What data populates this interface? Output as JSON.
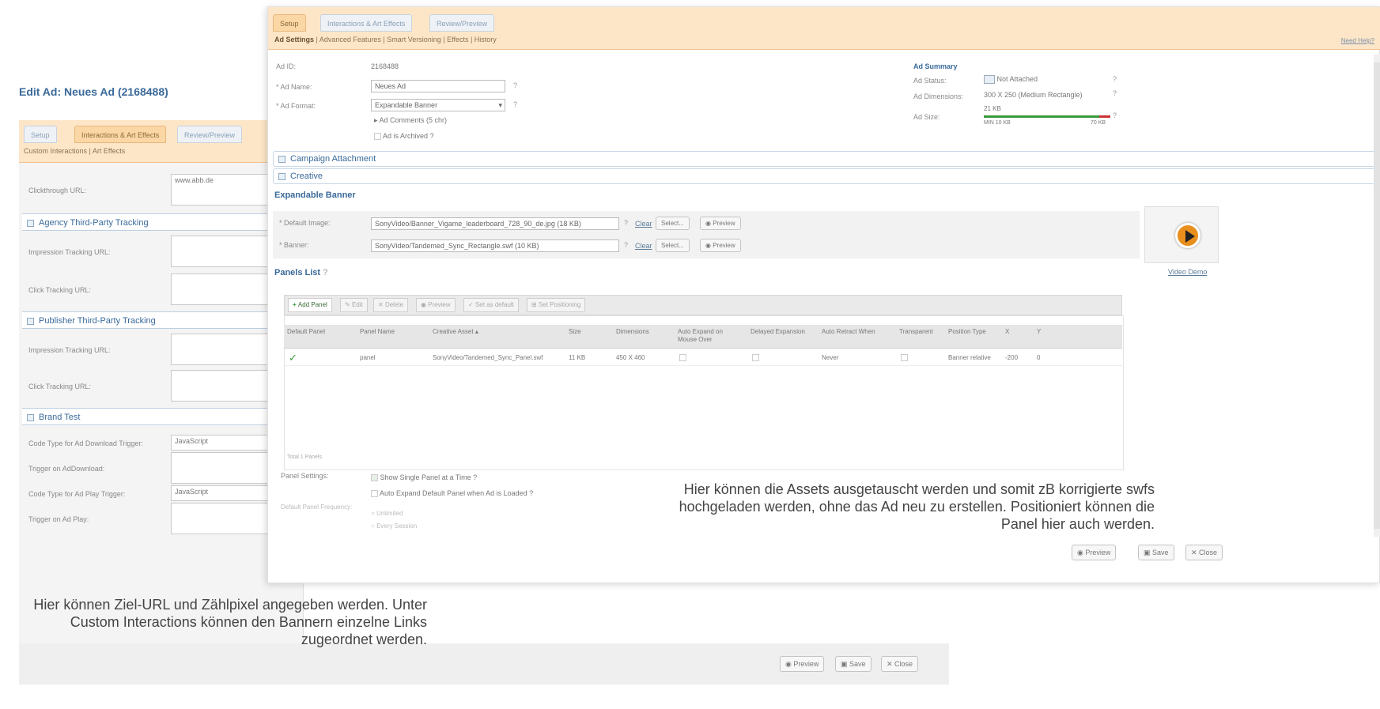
{
  "back": {
    "title": "Edit Ad: Neues Ad (2168488)",
    "tabs": [
      "Setup",
      "Interactions & Art Effects",
      "Review/Preview"
    ],
    "subnav": "Custom Interactions  |  Art Effects",
    "clickthrough_label": "Clickthrough URL:",
    "clickthrough_value": "www.abb.de",
    "agency_section": "Agency Third-Party Tracking",
    "impression_label": "Impression Tracking URL:",
    "click_label": "Click Tracking URL:",
    "publisher_section": "Publisher Third-Party Tracking",
    "pub_impression_label": "Impression Tracking URL:",
    "pub_click_label": "Click Tracking URL:",
    "brand_section": "Brand Test",
    "code_download_label": "Code Type for Ad Download Trigger:",
    "code_download_value": "JavaScript",
    "trigger_download_label": "Trigger on AdDownload:",
    "code_play_label": "Code Type for Ad Play Trigger:",
    "code_play_value": "JavaScript",
    "trigger_play_label": "Trigger on Ad Play:",
    "preview_btn": "Preview",
    "save_btn": "Save",
    "close_btn": "Close"
  },
  "front": {
    "tabs": [
      "Setup",
      "Interactions & Art Effects",
      "Review/Preview"
    ],
    "subnav_active": "Ad Settings",
    "subnav_rest": "  |  Advanced Features  |  Smart Versioning  |  Effects  |  History",
    "help_link": "Need Help?",
    "ad_id_label": "Ad ID:",
    "ad_id_value": "2168488",
    "ad_name_label": "* Ad Name:",
    "ad_name_value": "Neues Ad",
    "ad_format_label": "* Ad Format:",
    "ad_format_value": "Expandable Banner",
    "ad_comments": "Ad Comments (5 chr)",
    "archived": "Ad is Archived",
    "summary_title": "Ad Summary",
    "summary_status_label": "Ad Status:",
    "summary_status_value": "Not Attached",
    "summary_dims_label": "Ad Dimensions:",
    "summary_dims_value": "300 X 250 (Medium Rectangle)",
    "summary_size_label": "Ad Size:",
    "summary_size_top": "21 KB",
    "summary_size_scale": [
      "MIN 10 KB",
      "70 KB"
    ],
    "campaign_section": "Campaign Attachment",
    "creative_section": "Creative",
    "expandable_title": "Expandable Banner",
    "default_image_label": "* Default Image:",
    "default_image_value": "SonyVideo/Banner_Vigame_leaderboard_728_90_de.jpg (18 KB)",
    "banner_label": "* Banner:",
    "banner_value": "SonyVideo/Tandemed_Sync_Rectangle.swf (10 KB)",
    "clear": "Clear",
    "select": "Select...",
    "preview": "Preview",
    "video_demo": "Video Demo",
    "panels_title": "Panels List",
    "toolbar": [
      "Add Panel",
      "Edit",
      "Delete",
      "Preview",
      "Set as default",
      "Set Positioning"
    ],
    "columns": [
      "Default Panel",
      "Panel Name",
      "Creative Asset",
      "Size",
      "Dimensions",
      "Auto Expand on Mouse Over",
      "Delayed Expansion",
      "Auto Retract When",
      "Transparent",
      "Position Type",
      "X",
      "Y"
    ],
    "rows": [
      {
        "default": "✓",
        "name": "panel",
        "asset": "SonyVideo/Tandemed_Sync_Panel.swf",
        "size": "11 KB",
        "dims": "450 X 460",
        "retract": "Never",
        "pos_type": "Banner relative",
        "x": "-200",
        "y": "0"
      }
    ],
    "panel_count": "Total 1 Panels",
    "panel_settings_label": "Panel Settings:",
    "show_single": "Show Single Panel at a Time",
    "auto_expand": "Auto Expand Default Panel when Ad is Loaded",
    "default_frequency_label": "Default Panel Frequency:",
    "unlimited": "Unlimited",
    "every_session": "Every Session",
    "preview_btn": "Preview",
    "save_btn": "Save",
    "close_btn": "Close"
  },
  "notes": {
    "right": "Hier können die Assets ausgetauscht werden und somit zB korrigierte swfs hochgeladen werden, ohne das Ad neu zu erstellen. Positioniert können die Panel hier auch werden.",
    "left": "Hier können Ziel-URL und Zählpixel angegeben werden. Unter Custom Interactions können den Bannern einzelne Links zugeordnet werden."
  }
}
